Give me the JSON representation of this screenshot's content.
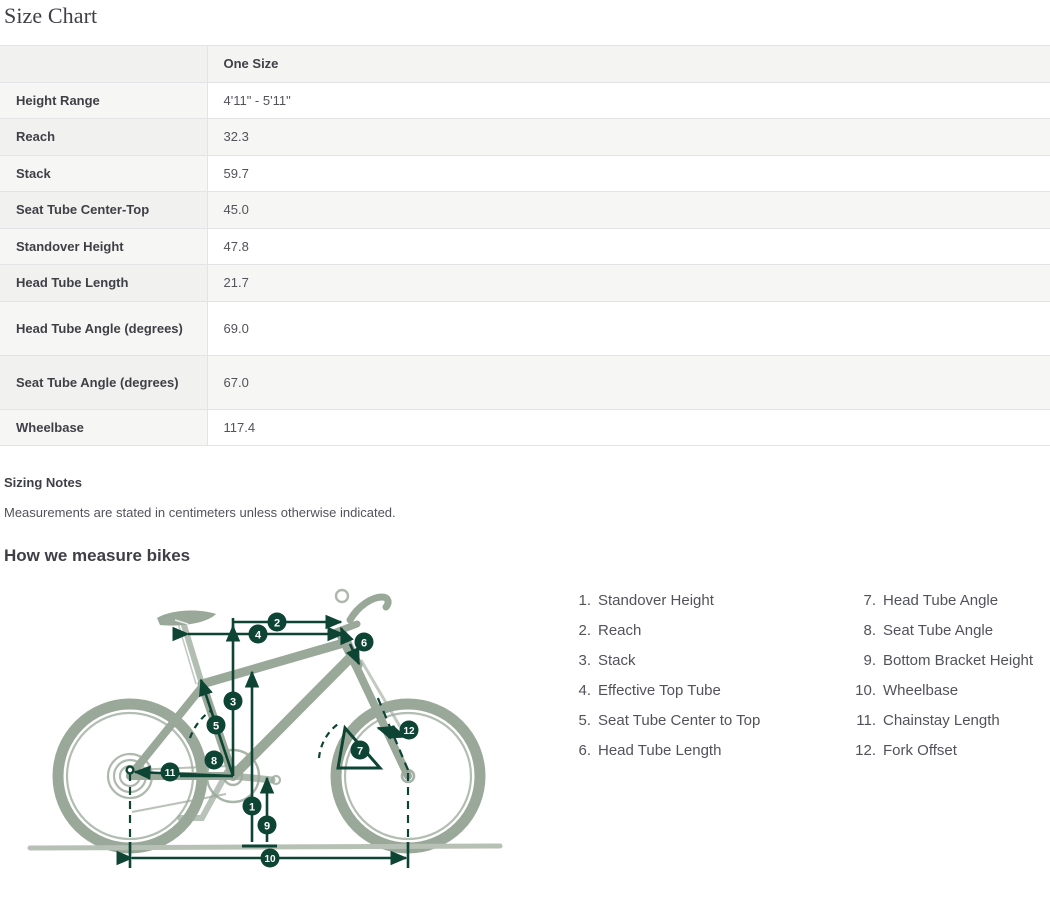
{
  "page_title": "Size Chart",
  "table": {
    "header": {
      "label": "",
      "value": "One Size"
    },
    "rows": [
      {
        "label": "Height Range",
        "value": "4'11\" - 5'11\""
      },
      {
        "label": "Reach",
        "value": "32.3"
      },
      {
        "label": "Stack",
        "value": "59.7"
      },
      {
        "label": "Seat Tube Center-Top",
        "value": "45.0"
      },
      {
        "label": "Standover Height",
        "value": "47.8"
      },
      {
        "label": "Head Tube Length",
        "value": "21.7"
      },
      {
        "label": "Head Tube Angle (degrees)",
        "value": "69.0"
      },
      {
        "label": "Seat Tube Angle (degrees)",
        "value": "67.0"
      },
      {
        "label": "Wheelbase",
        "value": "117.4"
      }
    ]
  },
  "notes": {
    "title": "Sizing Notes",
    "body": "Measurements are stated in centimeters unless otherwise indicated."
  },
  "measure": {
    "title": "How we measure bikes",
    "legend_left": [
      {
        "num": "1.",
        "text": "Standover Height"
      },
      {
        "num": "2.",
        "text": "Reach"
      },
      {
        "num": "3.",
        "text": "Stack"
      },
      {
        "num": "4.",
        "text": "Effective Top Tube"
      },
      {
        "num": "5.",
        "text": "Seat Tube Center to Top"
      },
      {
        "num": "6.",
        "text": "Head Tube Length"
      }
    ],
    "legend_right": [
      {
        "num": "7.",
        "text": "Head Tube Angle"
      },
      {
        "num": "8.",
        "text": "Seat Tube Angle"
      },
      {
        "num": "9.",
        "text": "Bottom Bracket Height"
      },
      {
        "num": "10.",
        "text": "Wheelbase"
      },
      {
        "num": "11.",
        "text": "Chainstay Length"
      },
      {
        "num": "12.",
        "text": "Fork Offset"
      }
    ],
    "diagram_callouts": [
      "1",
      "2",
      "3",
      "4",
      "5",
      "6",
      "7",
      "8",
      "9",
      "10",
      "11",
      "12"
    ],
    "colors": {
      "frame": "#9aa89a",
      "measure": "#0d4434",
      "ground": "#b7c0b5"
    }
  }
}
